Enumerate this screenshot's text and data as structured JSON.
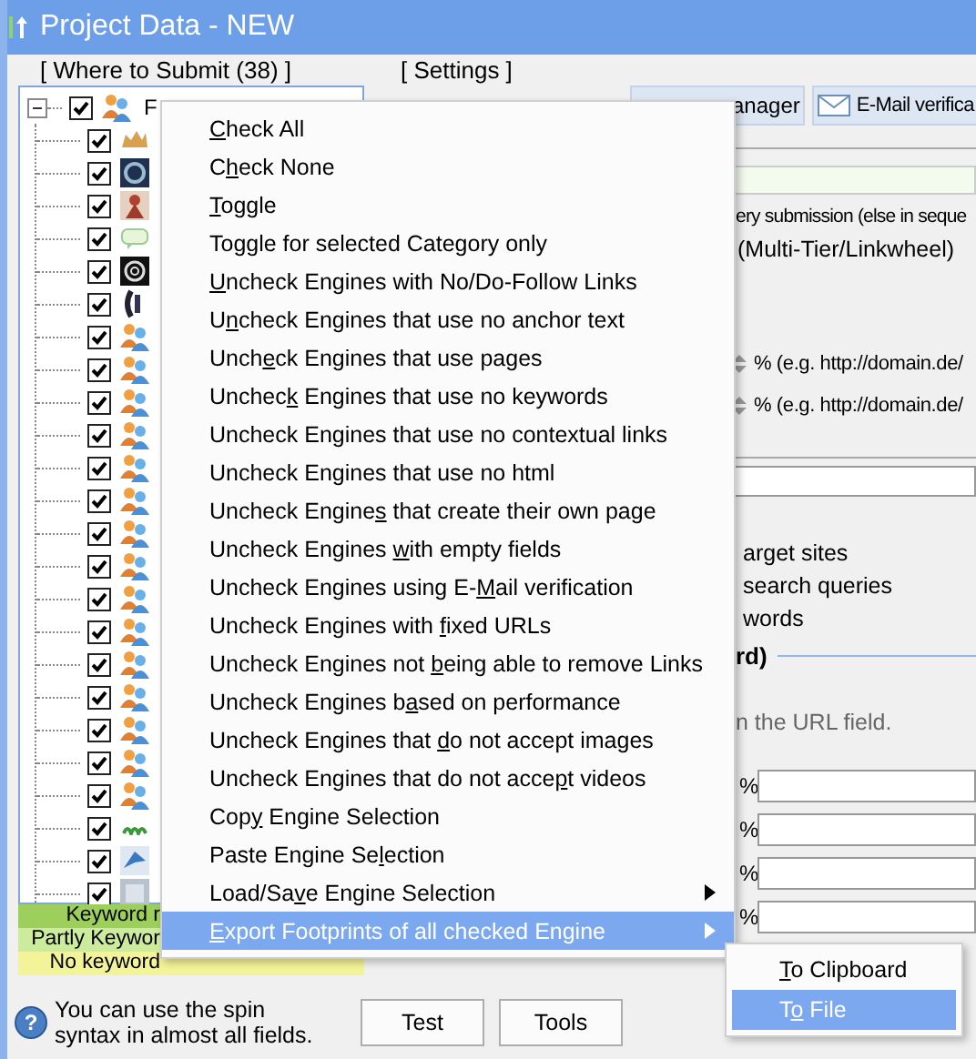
{
  "window": {
    "title": "Project Data - NEW"
  },
  "where_to_submit": {
    "title": "[ Where to Submit  (38) ]",
    "tree": {
      "label": "F",
      "checked": true,
      "expanded": true,
      "children": [
        {
          "kind": "camel",
          "checked": true
        },
        {
          "kind": "disc",
          "checked": true
        },
        {
          "kind": "figure",
          "checked": true
        },
        {
          "kind": "bubble",
          "checked": true
        },
        {
          "kind": "at",
          "checked": true
        },
        {
          "kind": "bracket",
          "checked": true
        },
        {
          "kind": "people",
          "checked": true
        },
        {
          "kind": "people",
          "checked": true
        },
        {
          "kind": "people",
          "checked": true
        },
        {
          "kind": "people",
          "checked": true
        },
        {
          "kind": "people",
          "checked": true
        },
        {
          "kind": "people",
          "checked": true
        },
        {
          "kind": "people",
          "checked": true
        },
        {
          "kind": "people",
          "checked": true
        },
        {
          "kind": "people",
          "checked": true
        },
        {
          "kind": "people",
          "checked": true
        },
        {
          "kind": "people",
          "checked": true
        },
        {
          "kind": "people",
          "checked": true
        },
        {
          "kind": "people",
          "checked": true
        },
        {
          "kind": "people",
          "checked": true
        },
        {
          "kind": "people",
          "checked": true
        },
        {
          "kind": "wave",
          "checked": true
        },
        {
          "kind": "bird",
          "checked": true
        },
        {
          "kind": "grey",
          "checked": true
        }
      ]
    },
    "legend": [
      {
        "label": "Keyword r",
        "color": "#9ccf5c"
      },
      {
        "label": "Partly Keywor",
        "color": "#cdeb9c"
      },
      {
        "label": "No keyword",
        "color": "#f3f39a"
      }
    ]
  },
  "settings": {
    "title": "[ Settings ]",
    "tabs": [
      "anager",
      "E-Mail verifica"
    ],
    "options": [
      "ery submission (else in seque",
      "(Multi-Tier/Linkwheel)"
    ],
    "variations": [
      "% (e.g. http://domain.de/",
      "% (e.g. http://domain.de/"
    ],
    "keyword_options": [
      "arget sites",
      "search queries",
      "words"
    ],
    "anchor_heading": "rd)",
    "anchor_hint": "n the URL field.",
    "anchor_percents": [
      "%",
      "%",
      "%",
      "%"
    ]
  },
  "hint": {
    "icon": "?",
    "text": "You can use the spin syntax in almost all fields."
  },
  "buttons": [
    "Test",
    "Tools"
  ],
  "context_menu": {
    "items": [
      {
        "key": "C",
        "after": "heck All",
        "has_submenu": false,
        "selected": false
      },
      {
        "before": "C",
        "key": "h",
        "after": "eck None",
        "has_submenu": false,
        "selected": false
      },
      {
        "key": "T",
        "after": "oggle",
        "has_submenu": false,
        "selected": false
      },
      {
        "before": "To",
        "key": "g",
        "after": "gle for selected Category only",
        "has_submenu": false,
        "selected": false
      },
      {
        "key": "U",
        "after": "ncheck Engines with No/Do-Follow Links",
        "has_submenu": false,
        "selected": false
      },
      {
        "before": "U",
        "key": "n",
        "after": "check Engines that use no anchor text",
        "has_submenu": false,
        "selected": false
      },
      {
        "before": "Unch",
        "key": "e",
        "after": "ck Engines that use pages",
        "has_submenu": false,
        "selected": false
      },
      {
        "before": "Unchec",
        "key": "k",
        "after": " Engines that use no keywords",
        "has_submenu": false,
        "selected": false
      },
      {
        "before": "Uncheck Engines that use no contextual links",
        "has_submenu": false,
        "selected": false
      },
      {
        "before": "Uncheck En",
        "key": "g",
        "after": "ines that use no html",
        "has_submenu": false,
        "selected": false
      },
      {
        "before": "Uncheck Engine",
        "key": "s",
        "after": " that create their own page",
        "has_submenu": false,
        "selected": false
      },
      {
        "before": "Uncheck Engines ",
        "key": "w",
        "after": "ith empty fields",
        "has_submenu": false,
        "selected": false
      },
      {
        "before": "Uncheck Engines using E-",
        "key": "M",
        "after": "ail verification",
        "has_submenu": false,
        "selected": false
      },
      {
        "before": "Uncheck Engines with ",
        "key": "f",
        "after": "ixed URLs",
        "has_submenu": false,
        "selected": false
      },
      {
        "before": "Uncheck Engines not ",
        "key": "b",
        "after": "eing able to remove Links",
        "has_submenu": false,
        "selected": false
      },
      {
        "before": "Uncheck Engines b",
        "key": "a",
        "after": "sed on performance",
        "has_submenu": false,
        "selected": false
      },
      {
        "before": "Uncheck Engines that ",
        "key": "d",
        "after": "o not accept images",
        "has_submenu": false,
        "selected": false
      },
      {
        "before": "Uncheck Engines that do not acce",
        "key": "p",
        "after": "t videos",
        "has_submenu": false,
        "selected": false
      },
      {
        "before": "Cop",
        "key": "y",
        "after": " Engine Selection",
        "has_submenu": false,
        "selected": false
      },
      {
        "before": "Paste Engine Se",
        "key": "l",
        "after": "ection",
        "has_submenu": false,
        "selected": false
      },
      {
        "before": "Load/Sa",
        "key": "v",
        "after": "e Engine Selection",
        "has_submenu": true,
        "selected": false
      },
      {
        "key": "E",
        "after": "xport Footprints of all checked Engine",
        "has_submenu": true,
        "selected": true
      }
    ]
  },
  "submenu": {
    "items": [
      {
        "key": "T",
        "after": "o Clipboard",
        "selected": false
      },
      {
        "before": "T",
        "key": "o",
        "after": " File",
        "selected": true
      }
    ]
  }
}
